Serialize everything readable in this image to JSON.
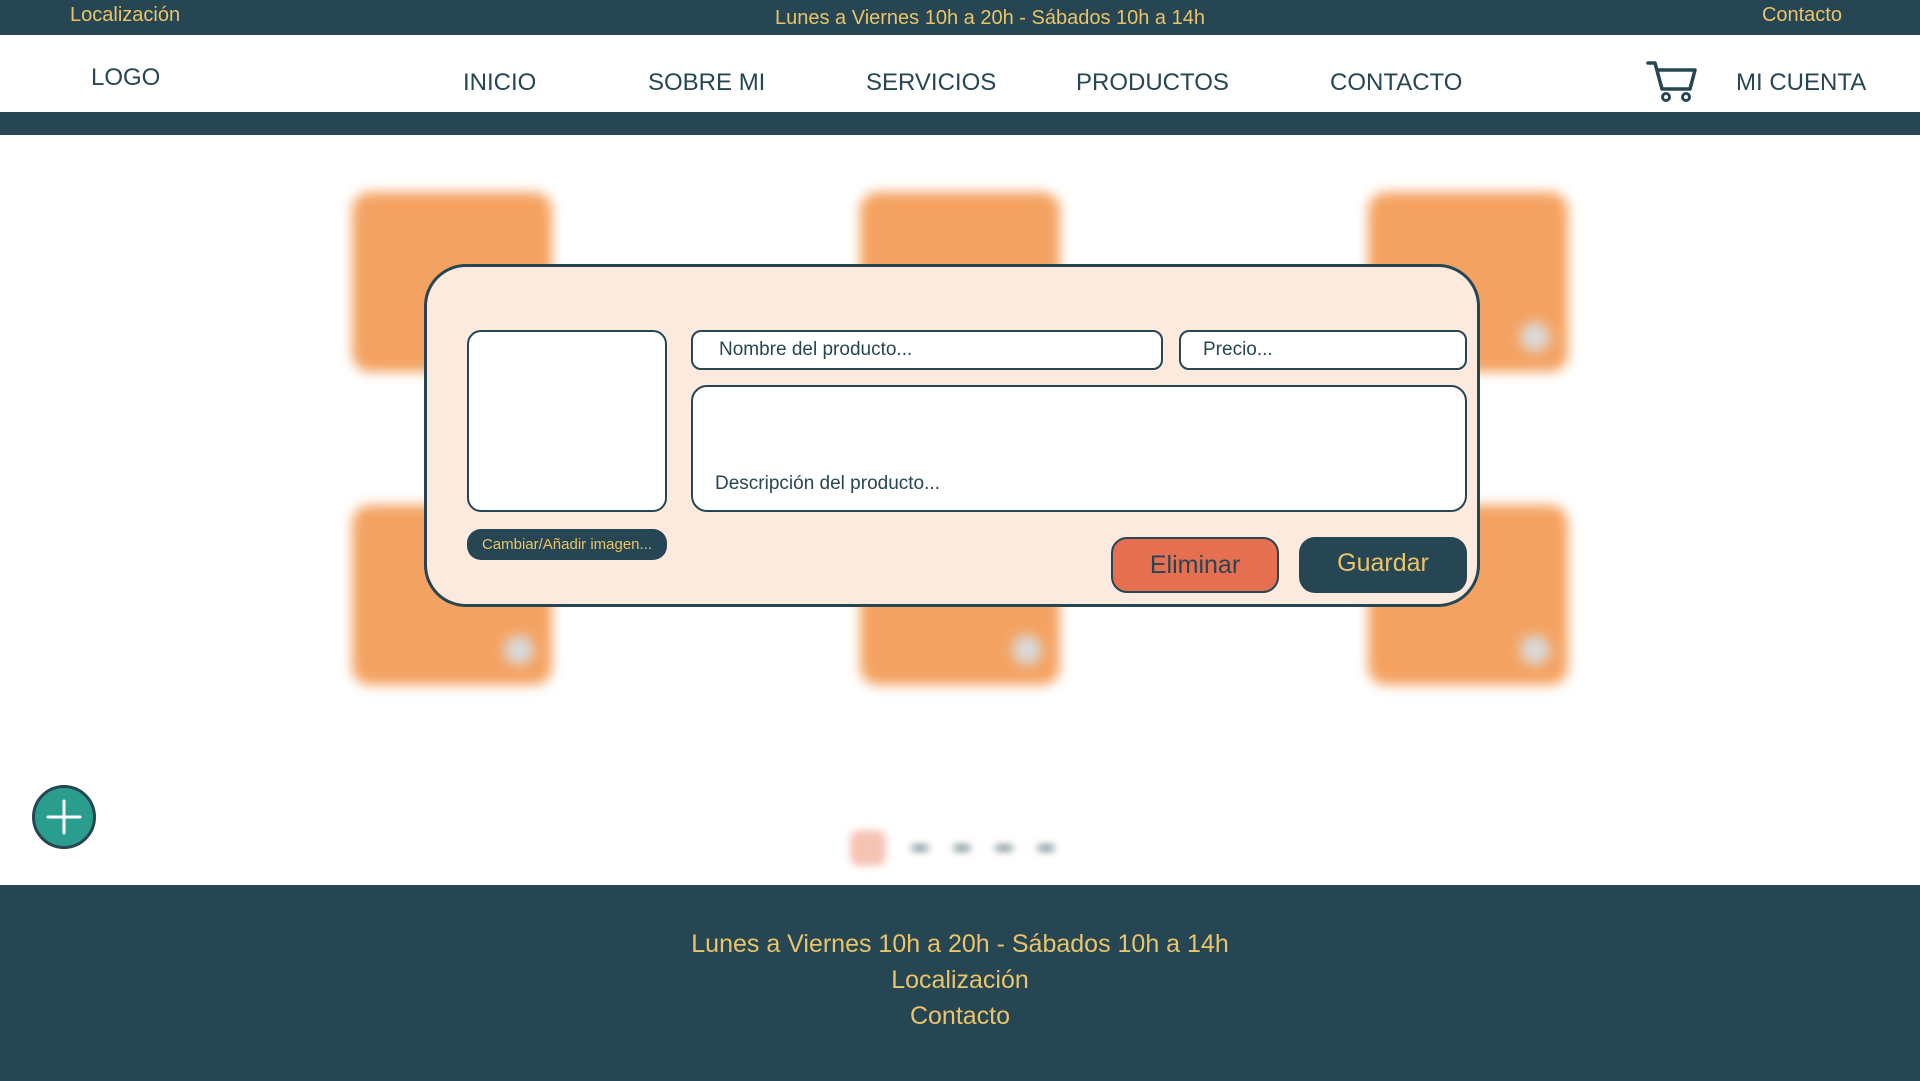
{
  "topbar": {
    "location": "Localización",
    "hours": "Lunes a Viernes 10h a 20h - Sábados 10h a 14h",
    "contact": "Contacto"
  },
  "nav": {
    "logo": "LOGO",
    "items": [
      "INICIO",
      "SOBRE MI",
      "SERVICIOS",
      "PRODUCTOS",
      "CONTACTO"
    ],
    "cart_icon": "cart-icon",
    "account": "MI CUENTA"
  },
  "add_button_icon": "plus-icon",
  "modal": {
    "image_button": "Cambiar/Añadir imagen...",
    "name_placeholder": "Nombre del producto...",
    "price_placeholder": "Precio...",
    "description_placeholder": "Descripción del producto...",
    "delete_label": "Eliminar",
    "save_label": "Guardar"
  },
  "footer": {
    "hours": "Lunes a Viernes 10h a 20h - Sábados 10h a 14h",
    "location": "Localización",
    "contact": "Contacto"
  },
  "colors": {
    "dark": "#264653",
    "accent": "#e9c46a",
    "orange": "#f4a261",
    "red": "#e76f51",
    "teal": "#2a9d8f",
    "modal_bg": "#fdeadf"
  }
}
